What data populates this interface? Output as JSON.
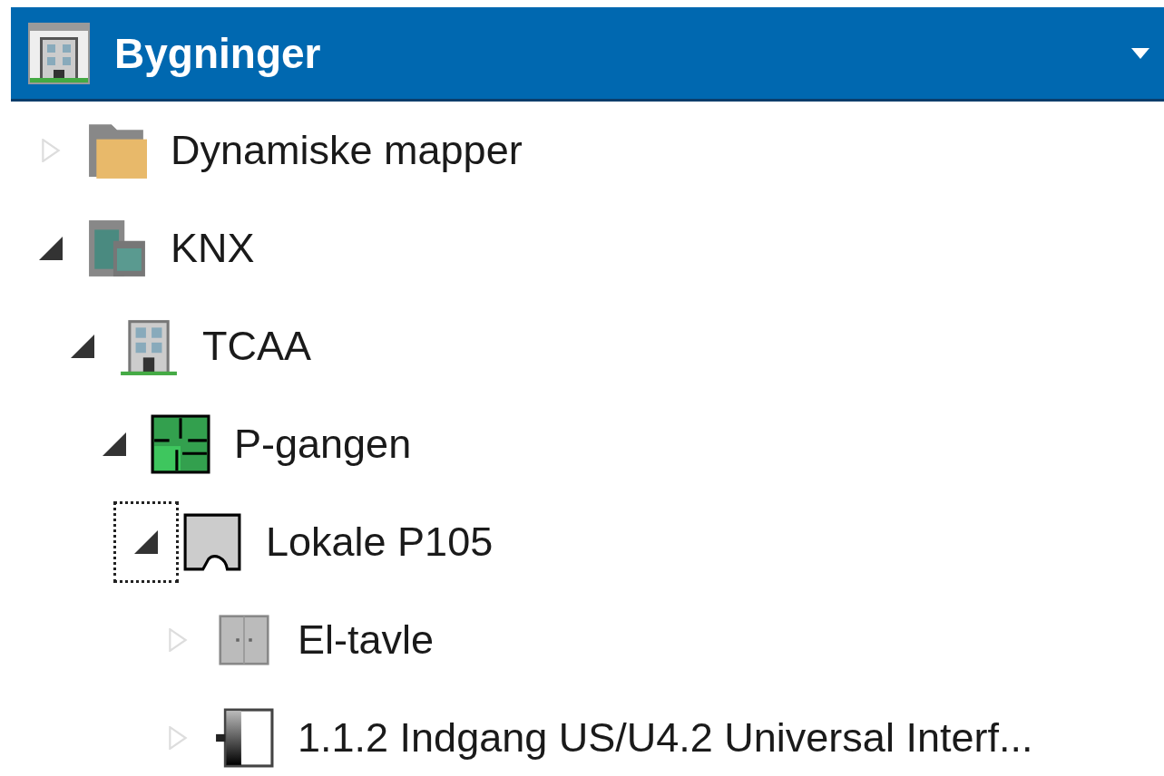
{
  "panel": {
    "title": "Bygninger"
  },
  "tree": [
    {
      "label": "Dynamiske mapper",
      "kind": "folder",
      "expanded": false,
      "focused": false
    },
    {
      "label": "KNX",
      "kind": "buildings",
      "expanded": true,
      "focused": false,
      "children": [
        {
          "label": "TCAA",
          "kind": "building",
          "expanded": true,
          "focused": false,
          "children": [
            {
              "label": "P-gangen",
              "kind": "floor",
              "expanded": true,
              "focused": false,
              "children": [
                {
                  "label": "Lokale P105",
                  "kind": "room",
                  "expanded": true,
                  "focused": true,
                  "children": [
                    {
                      "label": "El-tavle",
                      "kind": "cabinet",
                      "expanded": false,
                      "focused": false
                    },
                    {
                      "label": "1.1.2 Indgang US/U4.2 Universal Interf...",
                      "kind": "device",
                      "expanded": false,
                      "focused": false
                    }
                  ]
                }
              ]
            }
          ]
        }
      ]
    }
  ]
}
